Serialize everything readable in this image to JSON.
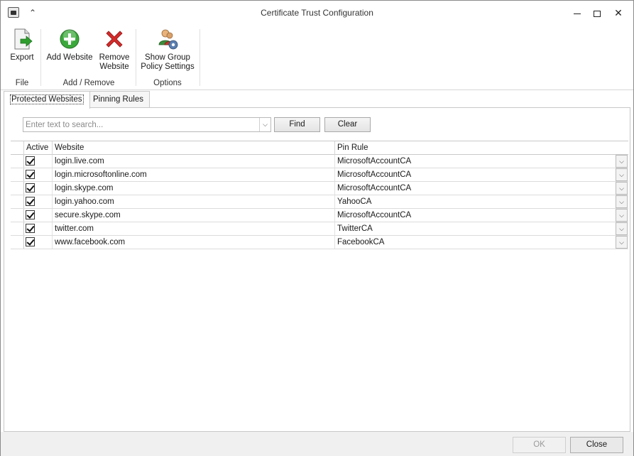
{
  "window": {
    "title": "Certificate Trust Configuration"
  },
  "ribbon": {
    "export_label": "Export",
    "add_label": "Add Website",
    "remove_label_1": "Remove",
    "remove_label_2": "Website",
    "group_policy_label_1": "Show Group",
    "group_policy_label_2": "Policy Settings",
    "groups": {
      "file": "File",
      "add_remove": "Add / Remove",
      "options": "Options"
    }
  },
  "tabs": [
    {
      "label": "Protected Websites",
      "active": true
    },
    {
      "label": "Pinning Rules",
      "active": false
    }
  ],
  "search": {
    "placeholder": "Enter text to search...",
    "find_label": "Find",
    "clear_label": "Clear"
  },
  "table": {
    "columns": {
      "active": "Active",
      "website": "Website",
      "pin_rule": "Pin Rule"
    },
    "rows": [
      {
        "active": true,
        "website": "login.live.com",
        "pin_rule": "MicrosoftAccountCA"
      },
      {
        "active": true,
        "website": "login.microsoftonline.com",
        "pin_rule": "MicrosoftAccountCA"
      },
      {
        "active": true,
        "website": "login.skype.com",
        "pin_rule": "MicrosoftAccountCA"
      },
      {
        "active": true,
        "website": "login.yahoo.com",
        "pin_rule": "YahooCA"
      },
      {
        "active": true,
        "website": "secure.skype.com",
        "pin_rule": "MicrosoftAccountCA"
      },
      {
        "active": true,
        "website": "twitter.com",
        "pin_rule": "TwitterCA"
      },
      {
        "active": true,
        "website": "www.facebook.com",
        "pin_rule": "FacebookCA"
      }
    ]
  },
  "footer": {
    "ok_label": "OK",
    "close_label": "Close"
  },
  "colors": {
    "add_green": "#3aa83a",
    "remove_red": "#d42b2b",
    "export_green": "#2f9e2f"
  }
}
